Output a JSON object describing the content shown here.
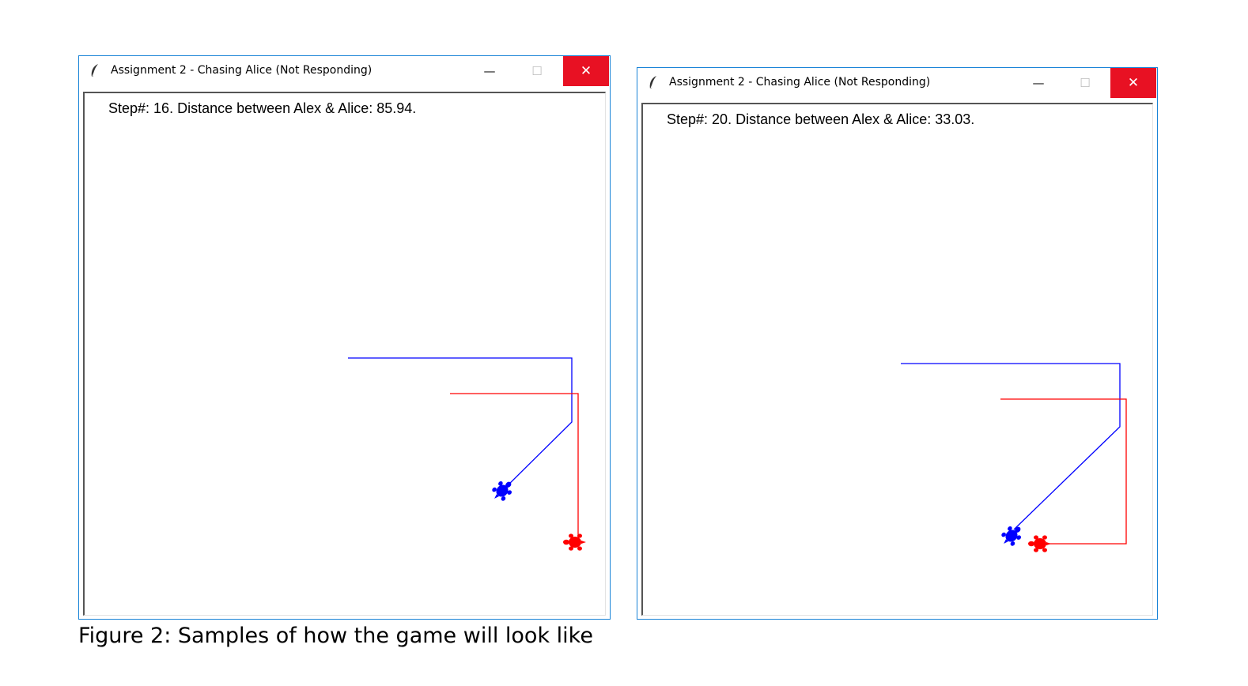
{
  "windows": [
    {
      "title": "Assignment 2 - Chasing Alice (Not Responding)",
      "minimize_glyph": "—",
      "maximize_glyph": "☐",
      "close_glyph": "✕",
      "status": "Step#: 16. Distance between Alex & Alice: 85.94.",
      "colors": {
        "alex": "#0000ff",
        "alice": "#ff0000"
      }
    },
    {
      "title": "Assignment 2 - Chasing Alice (Not Responding)",
      "minimize_glyph": "—",
      "maximize_glyph": "☐",
      "close_glyph": "✕",
      "status": "Step#: 20. Distance between Alex & Alice: 33.03.",
      "colors": {
        "alex": "#0000ff",
        "alice": "#ff0000"
      }
    }
  ],
  "caption": "Figure 2: Samples of how the game will look like",
  "icons": {
    "app": "feather-icon",
    "turtle": "turtle-icon"
  }
}
